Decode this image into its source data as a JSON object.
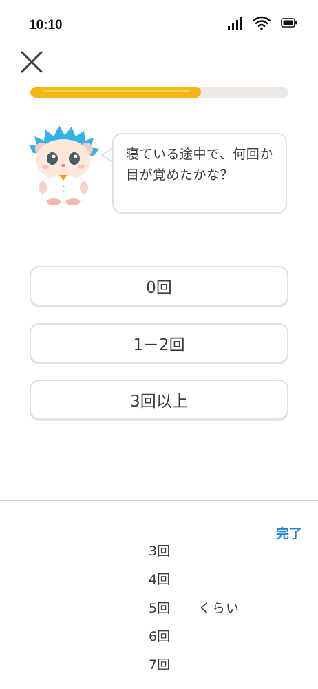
{
  "status_bar": {
    "time": "10:10",
    "icons": [
      "cellular-signal-icon",
      "wifi-icon",
      "battery-icon"
    ]
  },
  "header": {
    "close_icon": "close-icon",
    "progress_fraction": 0.66,
    "colors": {
      "progress": "#f7b614",
      "track": "#ece9e6"
    }
  },
  "question": {
    "mascot": "hedgehog-mascot",
    "text": "寝ている途中で、何回か目が覚めたかな？"
  },
  "answers": [
    {
      "label": "0回"
    },
    {
      "label": "1－2回"
    },
    {
      "label": "3回以上"
    }
  ],
  "picker": {
    "done_label": "完了",
    "items": [
      "3回",
      "4回",
      "5回",
      "6回",
      "7回"
    ],
    "selected": "5回",
    "unit": "くらい",
    "colors": {
      "done": "#1a8bd6"
    }
  }
}
